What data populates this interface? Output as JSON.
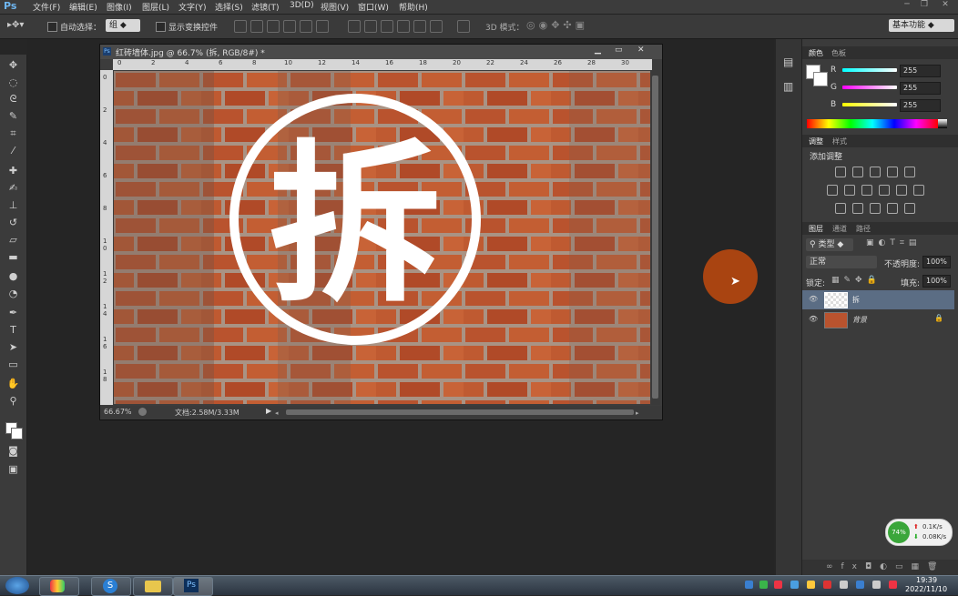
{
  "app": {
    "logo": "Ps"
  },
  "menu": [
    "文件(F)",
    "编辑(E)",
    "图像(I)",
    "图层(L)",
    "文字(Y)",
    "选择(S)",
    "滤镜(T)",
    "3D(D)",
    "视图(V)",
    "窗口(W)",
    "帮助(H)"
  ],
  "options": {
    "auto_select_label": "自动选择：",
    "auto_select_value": "组",
    "show_transform_label": "显示变换控件",
    "mode_3d_label": "3D 模式：",
    "workspace": "基本功能"
  },
  "document": {
    "title": "红砖墙体.jpg @ 66.7% (拆, RGB/8#) *",
    "ruler_h": [
      "0",
      "2",
      "4",
      "6",
      "8",
      "10",
      "12",
      "14",
      "16",
      "18",
      "20",
      "22",
      "24",
      "26",
      "28",
      "30"
    ],
    "ruler_v": [
      "0",
      "2",
      "4",
      "6",
      "8",
      "1 0",
      "1 2",
      "1 4",
      "1 6",
      "1 8"
    ],
    "glyph": "拆",
    "zoom": "66.67%",
    "doc_info": "文档:2.58M/3.33M"
  },
  "color_panel": {
    "tabs": [
      "颜色",
      "色板"
    ],
    "channels": [
      {
        "label": "R",
        "value": "255",
        "grad": "linear-gradient(90deg,#00ffff,#ffffff)"
      },
      {
        "label": "G",
        "value": "255",
        "grad": "linear-gradient(90deg,#ff00ff,#ffffff)"
      },
      {
        "label": "B",
        "value": "255",
        "grad": "linear-gradient(90deg,#ffff00,#ffffff)"
      }
    ]
  },
  "adjust_panel": {
    "tabs": [
      "调整",
      "样式"
    ],
    "title": "添加调整"
  },
  "layers_panel": {
    "tabs": [
      "图层",
      "通道",
      "路径"
    ],
    "filter": "类型",
    "blend": "正常",
    "opacity_label": "不透明度:",
    "opacity": "100%",
    "lock_label": "锁定:",
    "fill_label": "填充:",
    "fill": "100%",
    "layers": [
      {
        "name": "拆",
        "type": "transparent",
        "selected": true
      },
      {
        "name": "背景",
        "type": "brick",
        "selected": false,
        "locked": true
      }
    ]
  },
  "net_widget": {
    "percent": "74%",
    "up": "0.1K/s",
    "down": "0.08K/s"
  },
  "taskbar": {
    "time": "19:39",
    "date": "2022/11/10",
    "ps_label": "Ps"
  },
  "colors": {
    "accent_orange": "#b4460f",
    "brick": "#b9532e",
    "mortar": "#a99384"
  }
}
